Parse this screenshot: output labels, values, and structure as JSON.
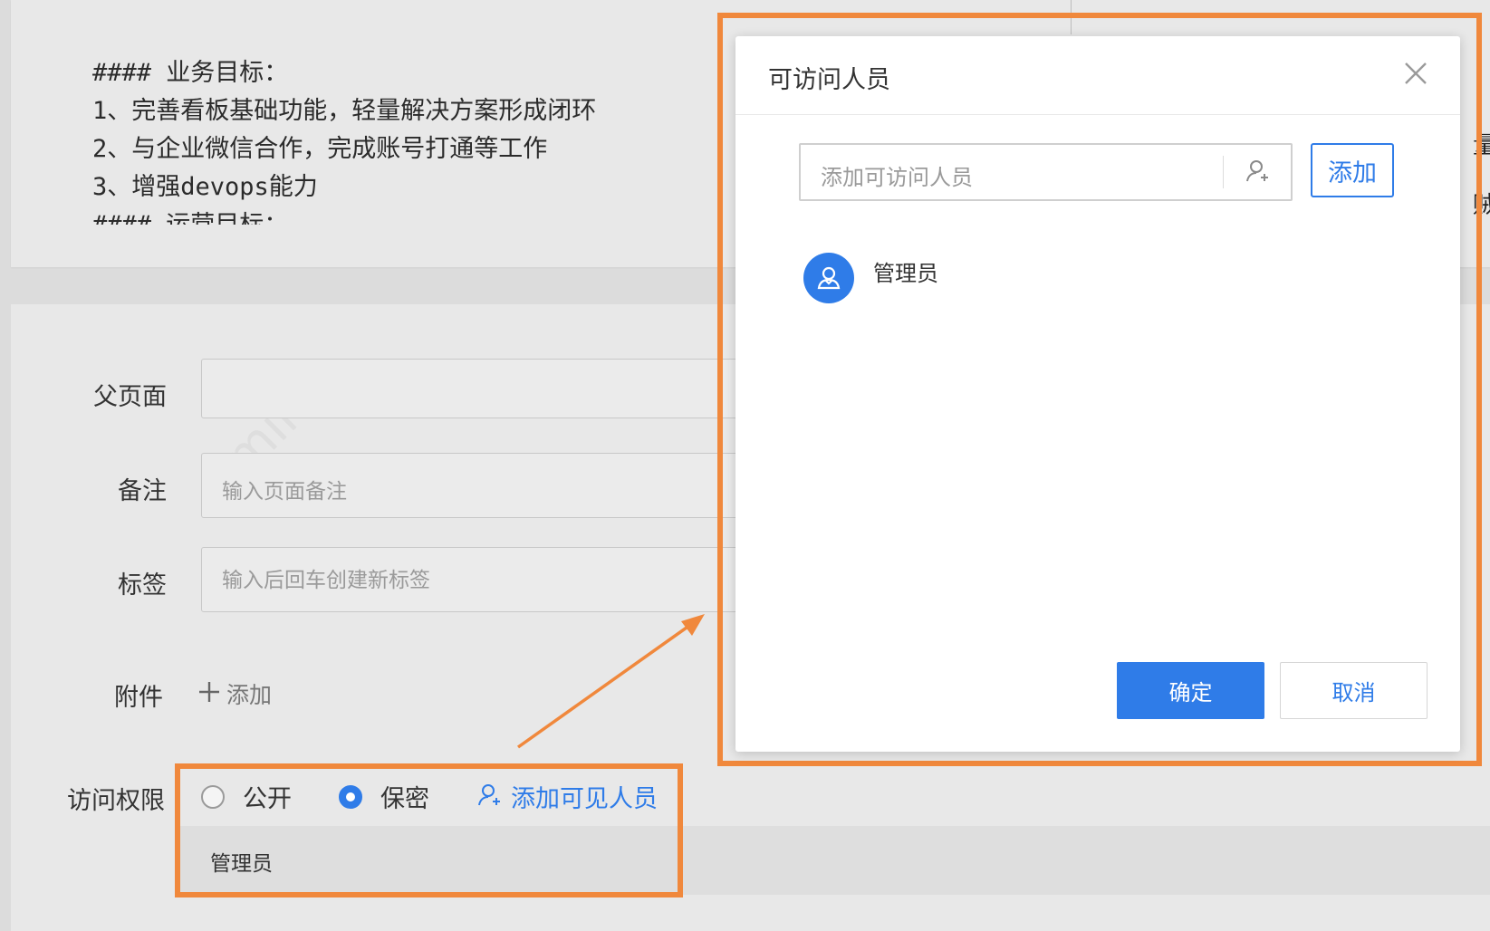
{
  "markdown": {
    "lines": [
      "#### 业务目标：",
      "1、完善看板基础功能，轻量解决方案形成闭环",
      "2、与企业微信合作，完成账号打通等工作",
      "3、增强devops能力",
      "",
      "#### 运营目标："
    ],
    "right_peek_1": "量",
    "right_peek_2": "贼"
  },
  "form": {
    "parent_label": "父页面",
    "parent_value": "",
    "remark_label": "备注",
    "remark_placeholder": "输入页面备注",
    "tags_label": "标签",
    "tags_placeholder": "输入后回车创建新标签",
    "attach_label": "附件",
    "attach_add": "添加",
    "access_label": "访问权限",
    "access_options": [
      "公开",
      "保密"
    ],
    "access_selected": "保密",
    "add_viewer": "添加可见人员",
    "viewers": [
      "管理员"
    ],
    "watermark": "mini"
  },
  "dialog": {
    "title": "可访问人员",
    "search_placeholder": "添加可访问人员",
    "add_button": "添加",
    "members": [
      "管理员"
    ],
    "confirm": "确定",
    "cancel": "取消"
  },
  "colors": {
    "accent": "#2f7ce8",
    "highlight": "#f0883c"
  }
}
